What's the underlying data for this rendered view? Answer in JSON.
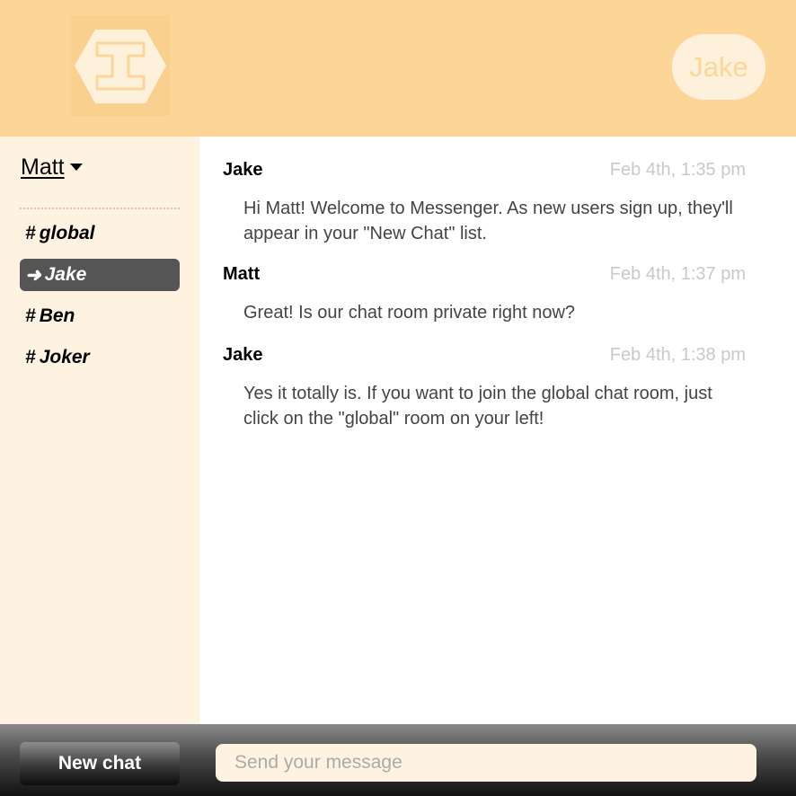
{
  "header": {
    "logo_icon": "hexagon-i-logo-icon",
    "user_pill": "Jake"
  },
  "sidebar": {
    "current_user": "Matt",
    "rooms": [
      {
        "prefix": "#",
        "label": "global",
        "active": false
      },
      {
        "prefix": "➜",
        "label": "Jake",
        "active": true
      },
      {
        "prefix": "#",
        "label": "Ben",
        "active": false
      },
      {
        "prefix": "#",
        "label": "Joker",
        "active": false
      }
    ]
  },
  "messages": [
    {
      "author": "Jake",
      "time": "Feb 4th, 1:35 pm",
      "text": "Hi Matt! Welcome to Messenger. As new users sign up, they'll appear in your \"New Chat\" list."
    },
    {
      "author": "Matt",
      "time": "Feb 4th, 1:37 pm",
      "text": "Great! Is our chat room private right now?"
    },
    {
      "author": "Jake",
      "time": "Feb 4th, 1:38 pm",
      "text": "Yes it totally is. If you want to join the global chat room, just click on the \"global\" room on your left!"
    }
  ],
  "footer": {
    "new_chat_label": "New chat",
    "message_placeholder": "Send your message",
    "message_value": ""
  },
  "colors": {
    "header": "#fcd699",
    "sidebar": "#fef3e0",
    "active_room": "#555555",
    "timestamp": "#c9c9c9"
  }
}
